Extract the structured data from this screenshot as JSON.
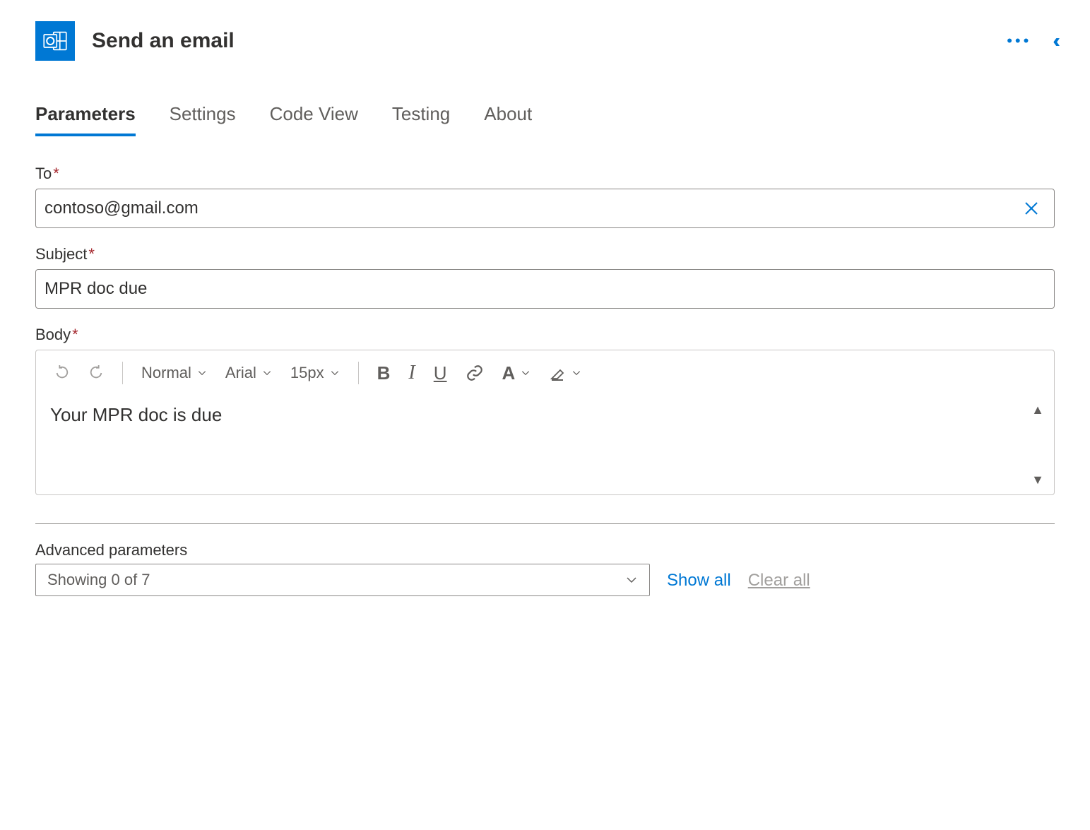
{
  "header": {
    "title": "Send an email"
  },
  "tabs": [
    "Parameters",
    "Settings",
    "Code View",
    "Testing",
    "About"
  ],
  "active_tab": 0,
  "fields": {
    "to": {
      "label": "To",
      "value": "contoso@gmail.com"
    },
    "subject": {
      "label": "Subject",
      "value": "MPR doc due"
    },
    "body": {
      "label": "Body",
      "value": "Your MPR doc is due"
    }
  },
  "editor_toolbar": {
    "style": "Normal",
    "font": "Arial",
    "size": "15px"
  },
  "advanced": {
    "label": "Advanced parameters",
    "summary": "Showing 0 of 7",
    "show_all": "Show all",
    "clear_all": "Clear all"
  }
}
